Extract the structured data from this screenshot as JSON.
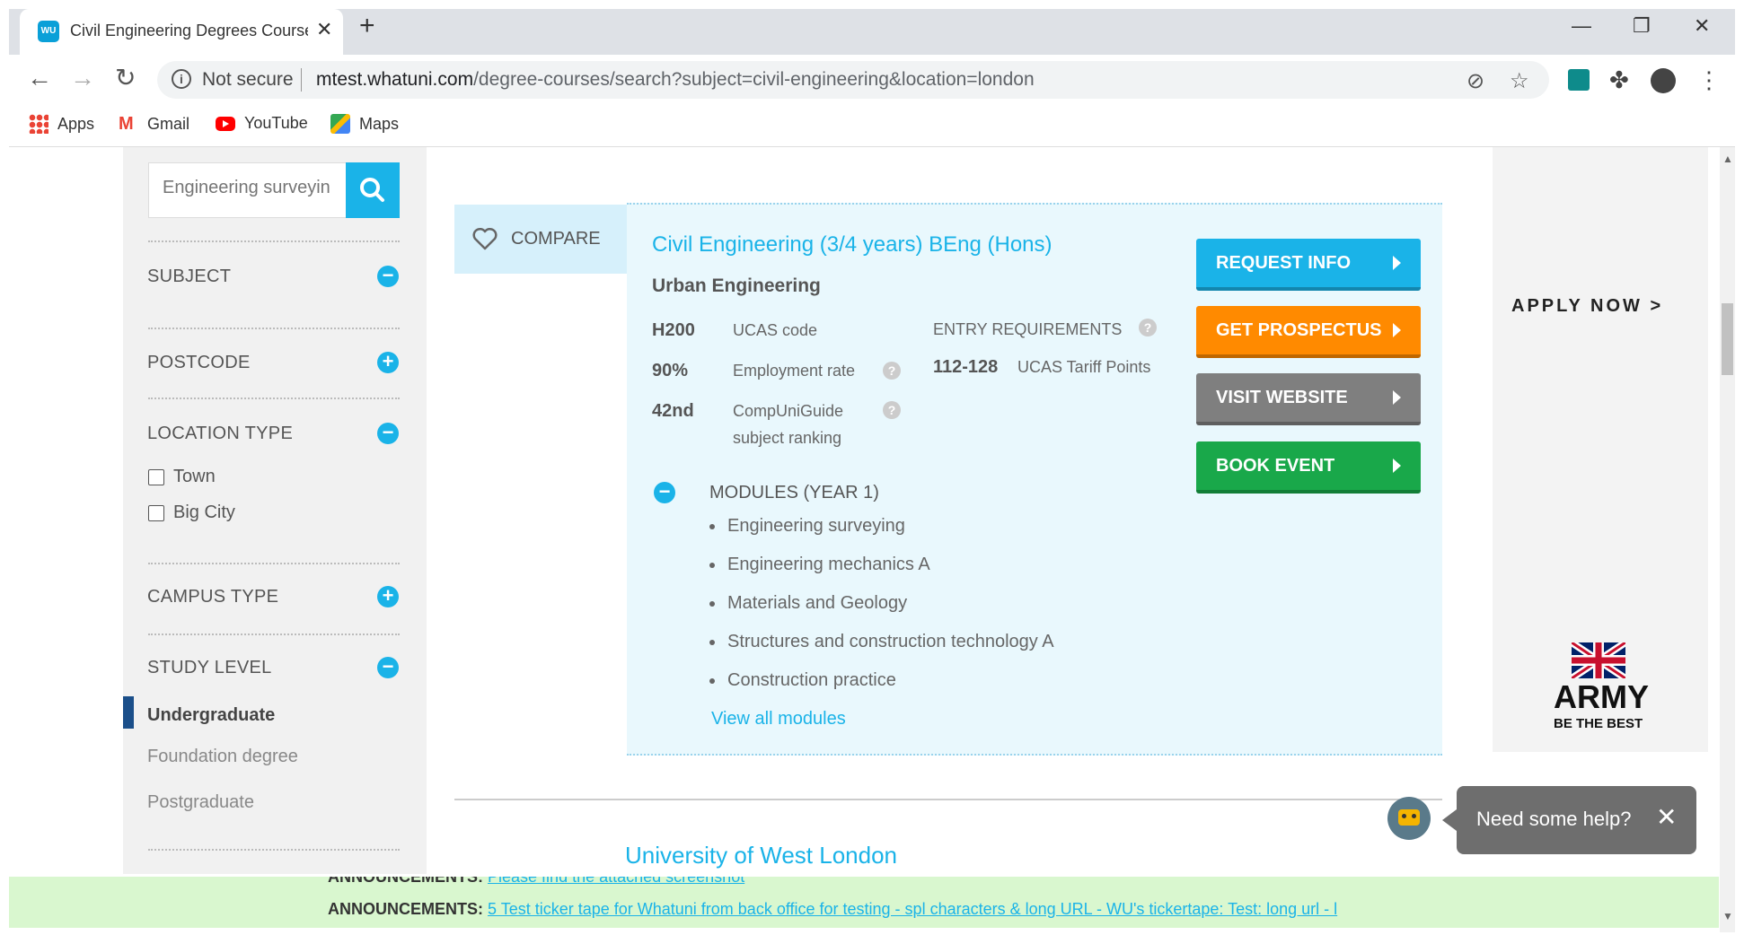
{
  "browser": {
    "tab_title": "Civil Engineering Degrees Course",
    "tab_favicon_text": "WU",
    "new_tab_symbol": "+",
    "security_label": "Not secure",
    "url_host": "mtest.whatuni.com",
    "url_path": "/degree-courses/search?subject=civil-engineering&location=london",
    "bookmarks": [
      {
        "label": "Apps",
        "icon": "apps-grid-icon"
      },
      {
        "label": "Gmail",
        "icon": "gmail-icon"
      },
      {
        "label": "YouTube",
        "icon": "youtube-icon"
      },
      {
        "label": "Maps",
        "icon": "maps-icon"
      }
    ]
  },
  "sidebar": {
    "search_placeholder": "Engineering surveyin",
    "filters": {
      "subject": "SUBJECT",
      "postcode": "POSTCODE",
      "location_type": "LOCATION TYPE",
      "campus_type": "CAMPUS TYPE",
      "study_level": "STUDY LEVEL"
    },
    "location_options": [
      "Town",
      "Big City"
    ],
    "study_levels": [
      "Undergraduate",
      "Foundation degree",
      "Postgraduate"
    ],
    "selected_level": "Undergraduate"
  },
  "course": {
    "compare_label": "COMPARE",
    "title": "Civil Engineering (3/4 years) BEng (Hons)",
    "subtitle": "Urban Engineering",
    "stats": [
      {
        "value": "H200",
        "label": "UCAS code"
      },
      {
        "value": "90%",
        "label": "Employment rate"
      },
      {
        "value": "42nd",
        "label_line1": "CompUniGuide",
        "label_line2": "subject ranking"
      }
    ],
    "entry_heading": "ENTRY REQUIREMENTS",
    "entry_value": "112-128",
    "entry_label": "UCAS Tariff Points",
    "modules_heading": "MODULES (YEAR 1)",
    "modules": [
      "Engineering surveying",
      "Engineering mechanics A",
      "Materials and Geology",
      "Structures and construction technology A",
      "Construction practice"
    ],
    "view_all": "View all modules",
    "buttons": [
      {
        "label": "REQUEST INFO",
        "color": "#1ab3e8"
      },
      {
        "label": "GET PROSPECTUS",
        "color": "#ff8a00"
      },
      {
        "label": "VISIT WEBSITE",
        "color": "#7f7f7f"
      },
      {
        "label": "BOOK EVENT",
        "color": "#19a84a"
      }
    ]
  },
  "ad": {
    "cta": "APPLY NOW >",
    "brand": "ARMY",
    "tagline": "BE THE BEST"
  },
  "next_result": "University of West London",
  "help": {
    "text": "Need some help?"
  },
  "ticker": {
    "label": "ANNOUNCEMENTS:",
    "line1": "Please find the attached screenshot",
    "line2": "5 Test ticker tape for Whatuni from back office for testing - spl characters & long URL - WU's tickertape: Test: long url - l"
  }
}
